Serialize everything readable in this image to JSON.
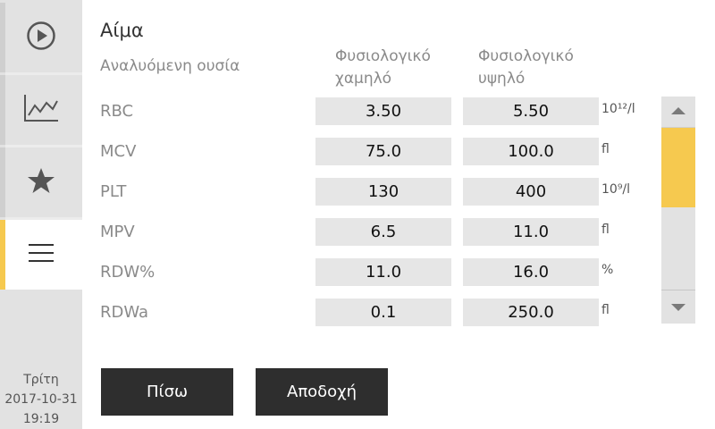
{
  "sidebar": {
    "items": [
      {
        "icon": "play-circle-icon",
        "active": false
      },
      {
        "icon": "line-chart-icon",
        "active": false
      },
      {
        "icon": "star-icon",
        "active": false
      },
      {
        "icon": "hamburger-menu-icon",
        "active": true
      }
    ],
    "day": "Τρίτη",
    "date": "2017-10-31",
    "time": "19:19"
  },
  "main": {
    "title": "Αίμα",
    "col_name": "Αναλυόμενη ουσία",
    "col_low": "Φυσιολογικό\nχαμηλό",
    "col_high": "Φυσιολογικό\nυψηλό",
    "rows": [
      {
        "name": "RBC",
        "low": "3.50",
        "high": "5.50",
        "unit": "10¹²/l"
      },
      {
        "name": "MCV",
        "low": "75.0",
        "high": "100.0",
        "unit": "fl"
      },
      {
        "name": "PLT",
        "low": "130",
        "high": "400",
        "unit": "10⁹/l"
      },
      {
        "name": "MPV",
        "low": "6.5",
        "high": "11.0",
        "unit": "fl"
      },
      {
        "name": "RDW%",
        "low": "11.0",
        "high": "16.0",
        "unit": "%"
      },
      {
        "name": "RDWa",
        "low": "0.1",
        "high": "250.0",
        "unit": "fl"
      }
    ]
  },
  "buttons": {
    "back": "Πίσω",
    "accept": "Αποδοχή"
  },
  "colors": {
    "accent": "#f6c94f",
    "sidebar_bg": "#e2e2e2",
    "button_bg": "#2e2e2e",
    "field_bg": "#e6e6e6"
  }
}
